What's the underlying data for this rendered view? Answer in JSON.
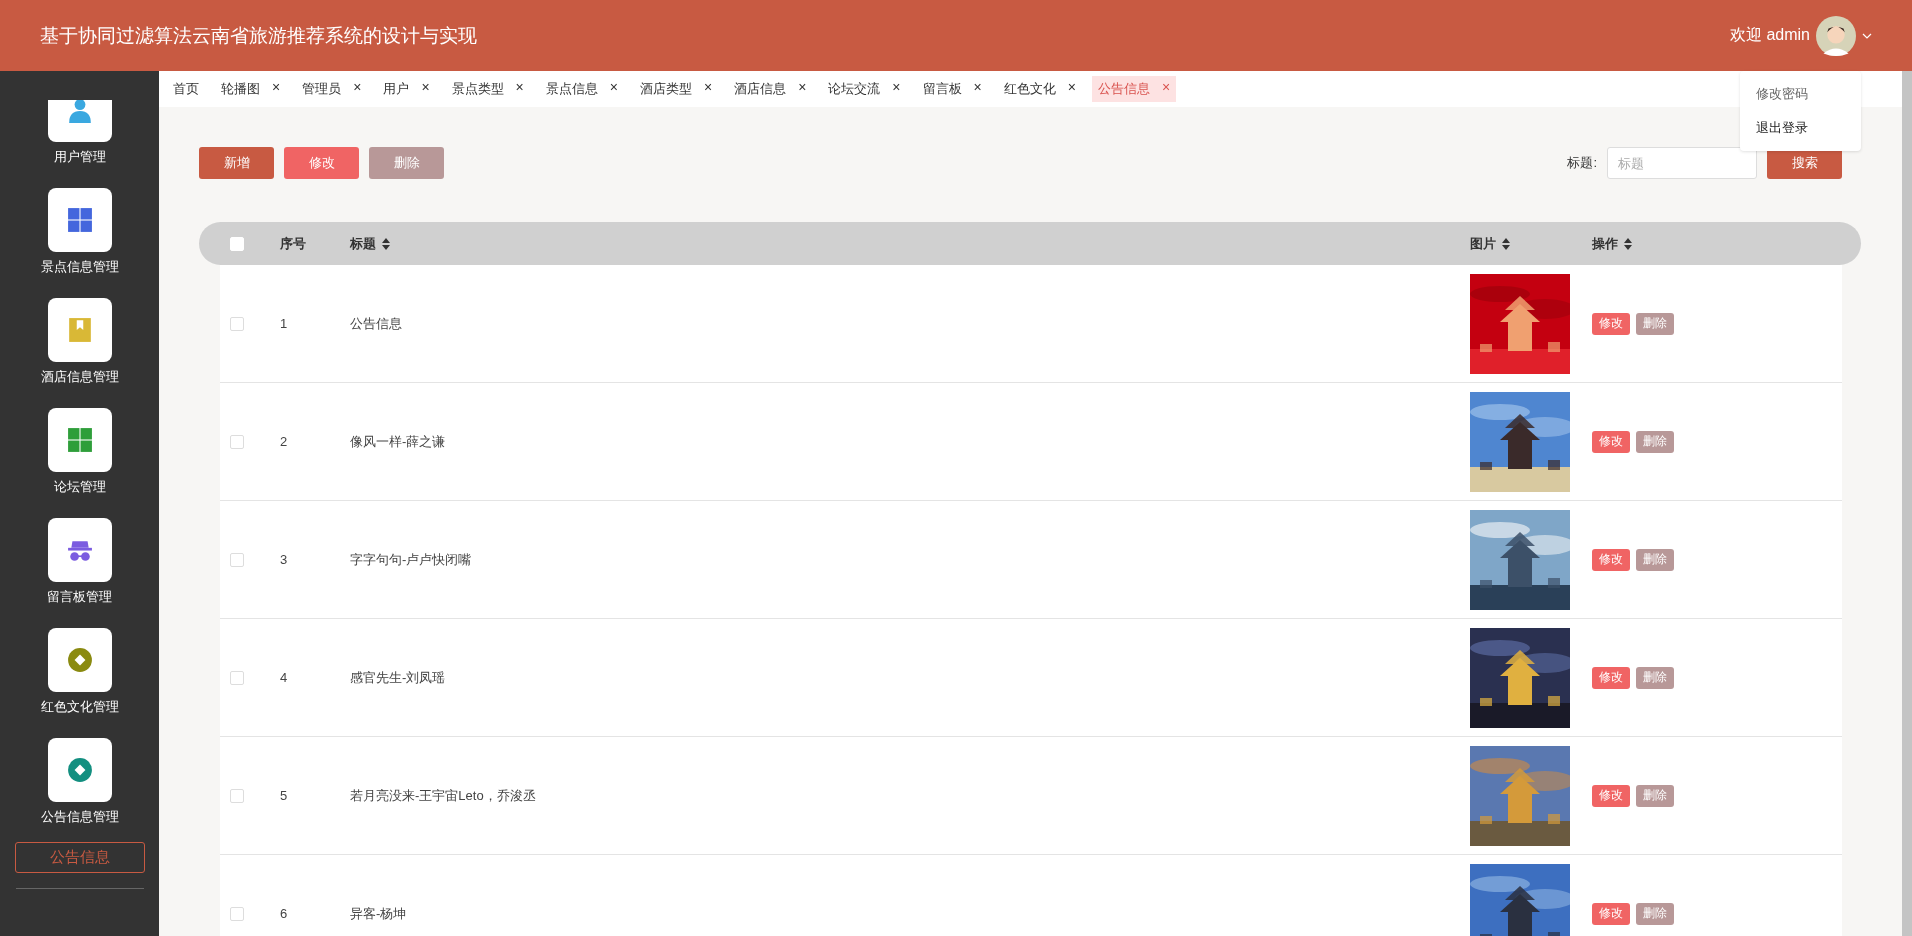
{
  "header": {
    "title": "基于协同过滤算法云南省旅游推荐系统的设计与实现",
    "greeting": "欢迎 admin"
  },
  "user_menu": {
    "open": true,
    "items": [
      "修改密码",
      "退出登录"
    ]
  },
  "sidebar": {
    "items": [
      {
        "label": "用户管理",
        "kind": "person",
        "color": "#3aa8e0"
      },
      {
        "label": "景点信息管理",
        "kind": "grid",
        "color": "#4466dd"
      },
      {
        "label": "酒店信息管理",
        "kind": "bookmark",
        "color": "#d9b836"
      },
      {
        "label": "论坛管理",
        "kind": "grid",
        "color": "#2e9e3a"
      },
      {
        "label": "留言板管理",
        "kind": "incognito",
        "color": "#7b5ce0"
      },
      {
        "label": "红色文化管理",
        "kind": "coin",
        "color": "#8a8a10"
      },
      {
        "label": "公告信息管理",
        "kind": "coin",
        "color": "#138f80"
      }
    ],
    "active_sub": "公告信息"
  },
  "tabs": [
    {
      "label": "首页",
      "closable": false,
      "selected": false
    },
    {
      "label": "轮播图",
      "closable": true,
      "selected": false
    },
    {
      "label": "管理员",
      "closable": true,
      "selected": false
    },
    {
      "label": "用户",
      "closable": true,
      "selected": false
    },
    {
      "label": "景点类型",
      "closable": true,
      "selected": false
    },
    {
      "label": "景点信息",
      "closable": true,
      "selected": false
    },
    {
      "label": "酒店类型",
      "closable": true,
      "selected": false
    },
    {
      "label": "酒店信息",
      "closable": true,
      "selected": false
    },
    {
      "label": "论坛交流",
      "closable": true,
      "selected": false
    },
    {
      "label": "留言板",
      "closable": true,
      "selected": false
    },
    {
      "label": "红色文化",
      "closable": true,
      "selected": false
    },
    {
      "label": "公告信息",
      "closable": true,
      "selected": true
    }
  ],
  "close_glyph": "×",
  "toolbar": {
    "buttons": [
      {
        "label": "新增",
        "kind": "add"
      },
      {
        "label": "修改",
        "kind": "edit"
      },
      {
        "label": "删除",
        "kind": "delete"
      }
    ],
    "search_label": "标题:",
    "search_placeholder": "标题",
    "search_button": "搜索"
  },
  "table": {
    "columns": [
      {
        "label": "序号",
        "sortable": false
      },
      {
        "label": "标题",
        "sortable": true
      },
      {
        "label": "图片",
        "sortable": true
      },
      {
        "label": "操作",
        "sortable": true
      }
    ],
    "select_all_checked": false,
    "rows": [
      {
        "index": "1",
        "title": "公告信息",
        "checked": false,
        "actions": [
          "修改",
          "删除"
        ]
      },
      {
        "index": "2",
        "title": "像风一样-薛之谦",
        "checked": false,
        "actions": [
          "修改",
          "删除"
        ]
      },
      {
        "index": "3",
        "title": "字字句句-卢卢快闭嘴",
        "checked": false,
        "actions": [
          "修改",
          "删除"
        ]
      },
      {
        "index": "4",
        "title": "感官先生-刘凤瑶",
        "checked": false,
        "actions": [
          "修改",
          "删除"
        ]
      },
      {
        "index": "5",
        "title": "若月亮没来-王宇宙Leto，乔浚丞",
        "checked": false,
        "actions": [
          "修改",
          "删除"
        ]
      },
      {
        "index": "6",
        "title": "异客-杨坤",
        "checked": false,
        "actions": [
          "修改",
          "删除"
        ]
      }
    ]
  }
}
